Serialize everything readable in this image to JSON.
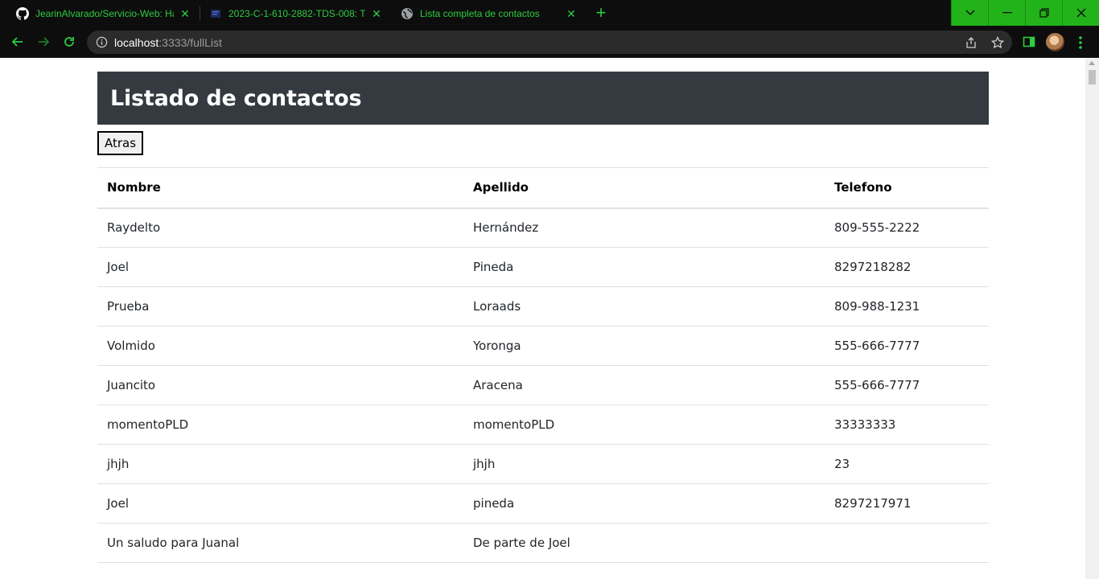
{
  "browser": {
    "tabs": [
      {
        "title": "JearinAlvarado/Servicio-Web: Ha",
        "icon": "github-icon"
      },
      {
        "title": "2023-C-1-610-2882-TDS-008: Ta",
        "icon": "document-icon"
      },
      {
        "title": "Lista completa de contactos",
        "icon": "globe-icon"
      }
    ],
    "url_host": "localhost",
    "url_path": ":3333/fullList",
    "accent_color": "#2ecc40",
    "window_control_color": "#22b31a"
  },
  "page": {
    "title": "Listado de contactos",
    "back_button": "Atras",
    "table": {
      "headers": [
        "Nombre",
        "Apellido",
        "Telefono"
      ],
      "rows": [
        [
          "Raydelto",
          "Hernández",
          "809-555-2222"
        ],
        [
          "Joel",
          "Pineda",
          "8297218282"
        ],
        [
          "Prueba",
          "Loraads",
          "809-988-1231"
        ],
        [
          "Volmido",
          "Yoronga",
          "555-666-7777"
        ],
        [
          "Juancito",
          "Aracena",
          "555-666-7777"
        ],
        [
          "momentoPLD",
          "momentoPLD",
          "33333333"
        ],
        [
          "jhjh",
          "jhjh",
          "23"
        ],
        [
          "Joel",
          "pineda",
          "8297217971"
        ],
        [
          "Un saludo para Juanal",
          "De parte de Joel",
          ""
        ]
      ]
    },
    "header_bg_color": "#343a40"
  }
}
